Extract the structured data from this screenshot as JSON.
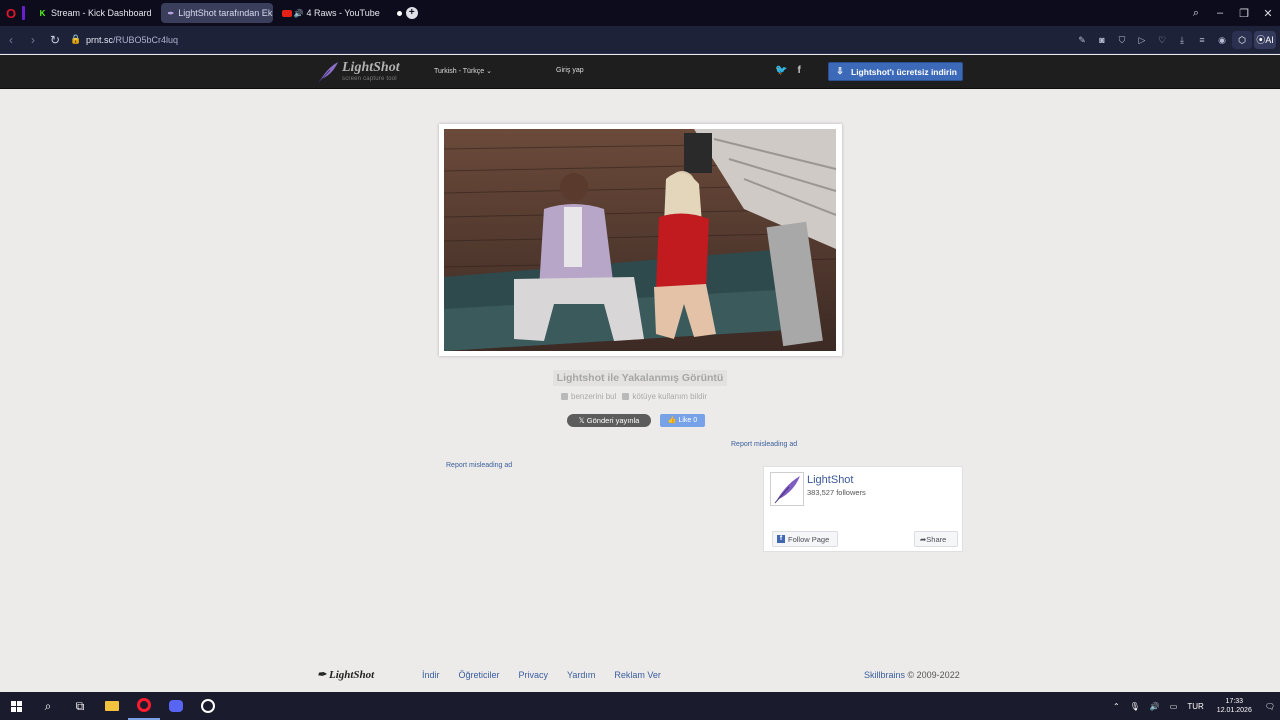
{
  "browser": {
    "tabs": [
      {
        "label": "Stream - Kick Dashboard",
        "active": false
      },
      {
        "label": "LightShot tarafından Ekra",
        "active": true
      },
      {
        "label": "4 Raws - YouTube",
        "active": false
      }
    ],
    "url_domain": "prnt.sc",
    "url_path": "/RUBO5bCr4luq"
  },
  "header": {
    "logo_title": "LightShot",
    "logo_subtitle": "screen capture tool",
    "language": "Turkish - Türkçe",
    "login": "Giriş yap",
    "download_label": "Lightshot'ı ücretsiz indirin"
  },
  "main": {
    "caption": "Lightshot ile Yakalanmış Görüntü",
    "find_similar": "benzerini bul",
    "report_abuse": "kötüye kullanım bildir",
    "tweet_label": "Gönderi yayınla",
    "like_label": "Like 0",
    "report_ad_right": "Report misleading ad",
    "report_ad_left": "Report misleading ad"
  },
  "facebook": {
    "name": "LightShot",
    "followers": "383,527 followers",
    "follow": "Follow Page",
    "share": "Share"
  },
  "footer": {
    "logo": "LightShot",
    "links": [
      "İndir",
      "Öğreticiler",
      "Privacy",
      "Yardım",
      "Reklam Ver"
    ],
    "company": "Skillbrains",
    "copyright": "© 2009-2022"
  },
  "taskbar": {
    "language": "TUR",
    "time": "17:33",
    "date": "12.01.2026"
  },
  "colors": {
    "page_bg": "#ecebea",
    "header_bg": "#1e1e1e",
    "download_btn": "#3d6ab8",
    "link": "#3a5e9c"
  }
}
